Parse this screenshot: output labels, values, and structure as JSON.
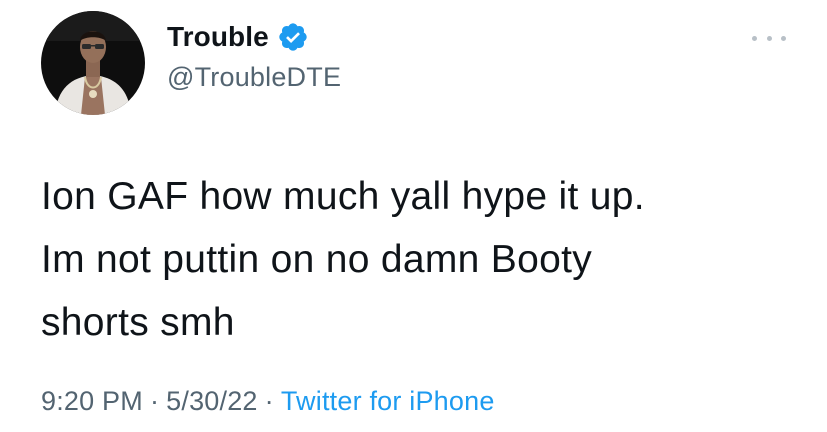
{
  "author": {
    "display_name": "Trouble",
    "handle": "@TroubleDTE",
    "verified": true,
    "avatar_icon": "user-avatar-photo"
  },
  "tweet": {
    "lines": [
      "Ion GAF how much yall hype it up.",
      "Im not puttin on no damn Booty",
      "shorts smh"
    ]
  },
  "meta": {
    "time": "9:20 PM",
    "separator": "·",
    "date": "5/30/22",
    "source": "Twitter for iPhone"
  },
  "colors": {
    "text": "#0f1419",
    "secondary": "#536471",
    "accent": "#1d9bf0",
    "more_dots": "#b8c0c7"
  },
  "icons": {
    "verified": "verified-badge-icon",
    "more": "more-options-icon"
  }
}
